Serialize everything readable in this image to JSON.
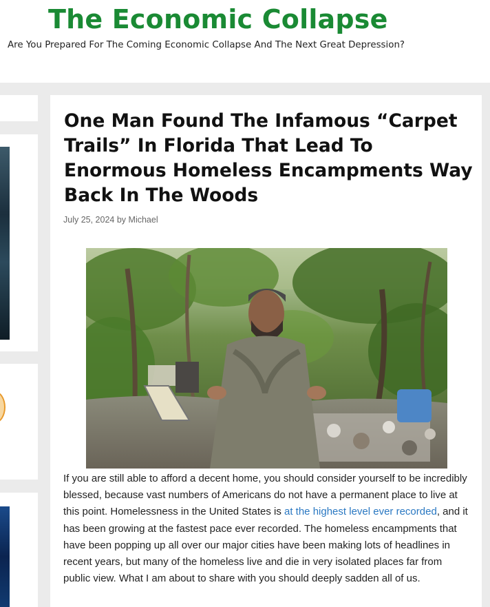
{
  "header": {
    "site_title": "The Economic Collapse",
    "tagline": "Are You Prepared For The Coming Economic Collapse And The Next Great Depression?",
    "title_color": "#1a8a34"
  },
  "article": {
    "title": "One Man Found The Infamous “Carpet Trails” In Florida That Lead To Enormous Homeless Encampments Way Back In The Woods",
    "date": "July 25, 2024",
    "by_label": "by",
    "author": "Michael",
    "image_description_icon": "photo-man-at-homeless-encampment",
    "paragraph": {
      "before_link": "If you are still able to afford a decent home, you should consider yourself to be incredibly blessed, because vast numbers of Americans do not have a permanent place to live at this point.  Homelessness in the United States is ",
      "link_text": "at the highest level ever recorded",
      "after_link": ", and it has been growing at the fastest pace ever recorded.  The homeless encampments that have been popping up all over our major cities have been making lots of headlines in recent years, but many of the homeless live and die in very isolated places far from public view.  What I am about to share with you should deeply sadden all of us."
    }
  },
  "colors": {
    "link": "#2a78c2",
    "background": "#ebebeb"
  }
}
